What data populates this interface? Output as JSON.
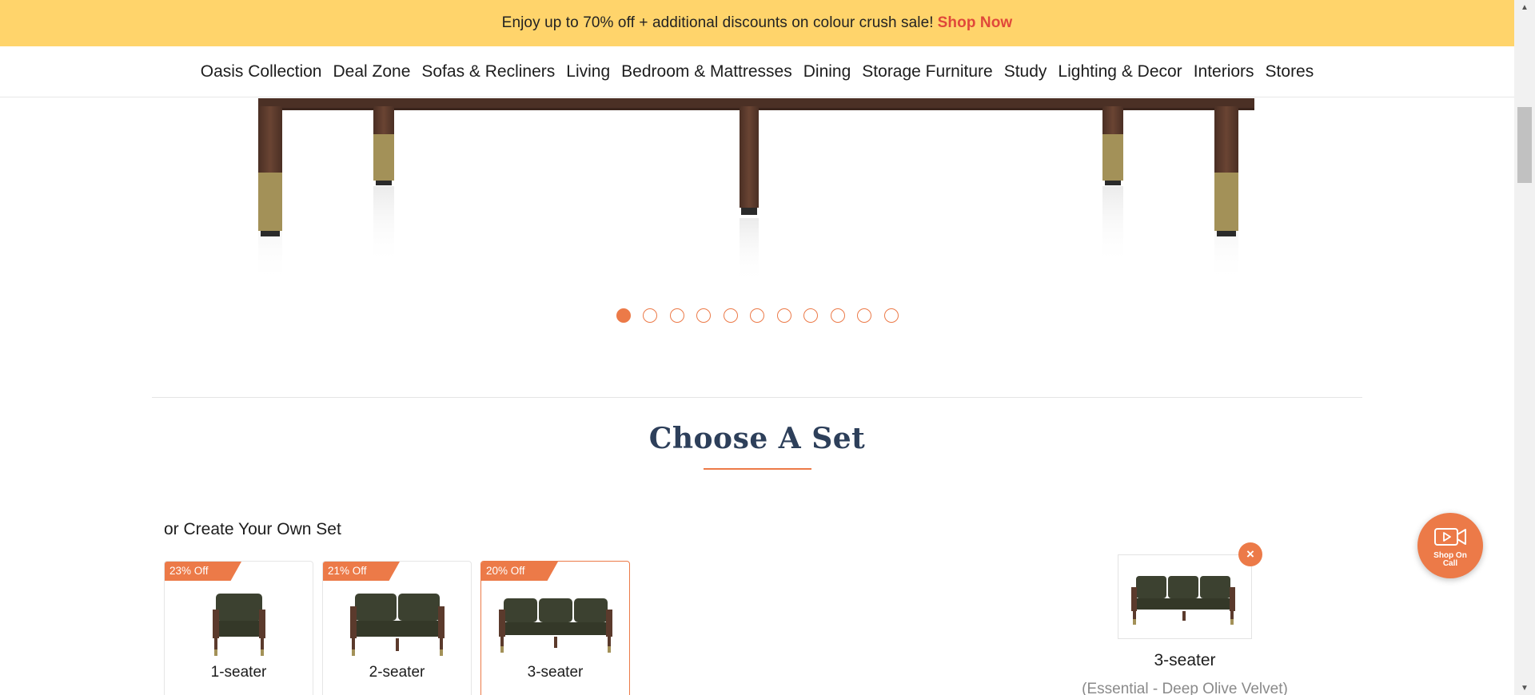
{
  "promo": {
    "text": "Enjoy up to 70% off + additional discounts on colour crush sale!",
    "cta": "Shop Now"
  },
  "nav": {
    "items": [
      "Oasis Collection",
      "Deal Zone",
      "Sofas & Recliners",
      "Living",
      "Bedroom & Mattresses",
      "Dining",
      "Storage Furniture",
      "Study",
      "Lighting & Decor",
      "Interiors",
      "Stores"
    ]
  },
  "carousel": {
    "total_slides": 11,
    "active_slide": 1
  },
  "section": {
    "title": "Choose A Set",
    "subtitle": "or Create Your Own Set"
  },
  "sets": [
    {
      "label": "1-seater",
      "discount": "23% Off",
      "selected": false
    },
    {
      "label": "2-seater",
      "discount": "21% Off",
      "selected": false
    },
    {
      "label": "3-seater",
      "discount": "20% Off",
      "selected": true
    }
  ],
  "selection": {
    "label": "3-seater",
    "detail": "(Essential - Deep Olive Velvet)",
    "remove_icon": "×"
  },
  "shop_on_call": {
    "label_line1": "Shop On",
    "label_line2": "Call"
  },
  "colors": {
    "accent": "#ec7a48",
    "promo_bg": "#ffd46b",
    "shop_now": "#e0483a",
    "title": "#2d3f5a",
    "sofa_fabric": "#3c4130",
    "wood": "#5b3a2c",
    "brass": "#a39158"
  }
}
